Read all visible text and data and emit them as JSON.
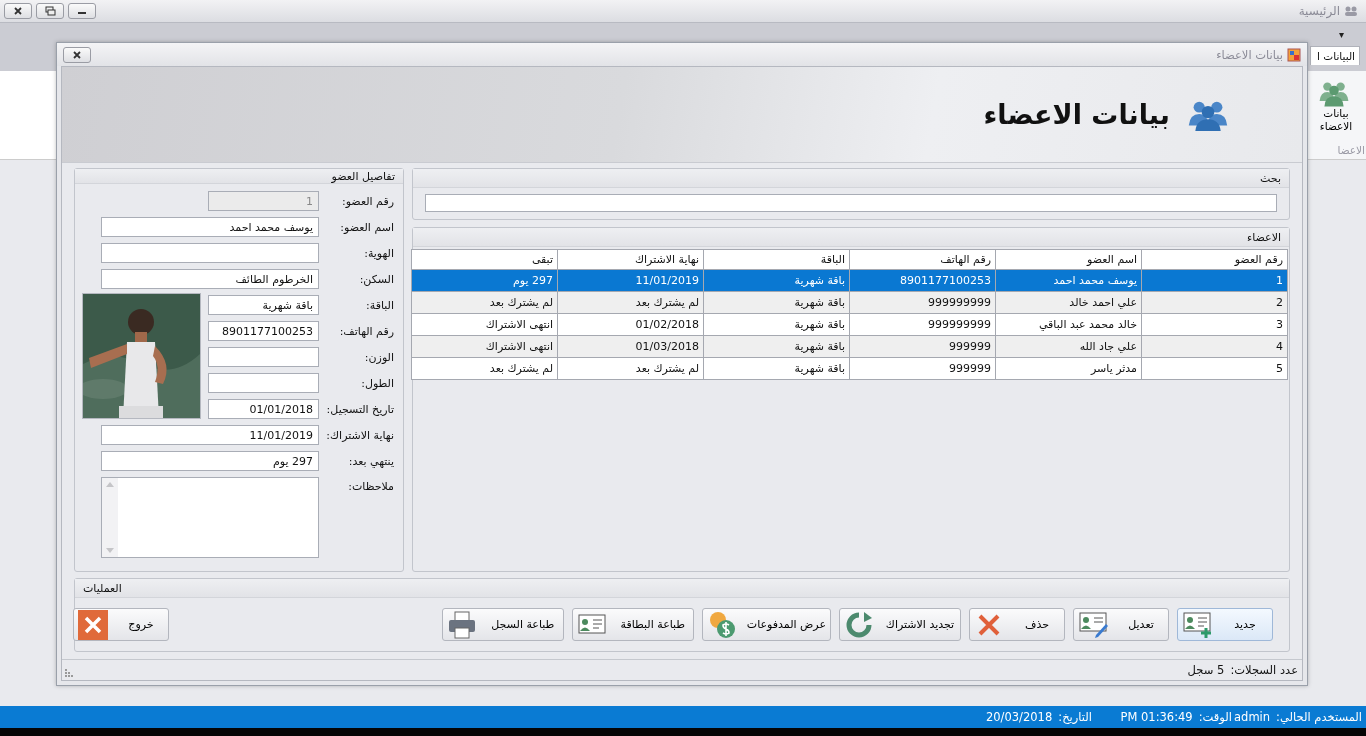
{
  "app": {
    "title": "الرئيسية"
  },
  "ribbon": {
    "menu_caret": "▾",
    "tab": "البيانات ا",
    "button": "بيانات الاعضاء",
    "group": "الاعضا"
  },
  "child_window": {
    "title": "بيانات الاعضاء",
    "heading": "بيانات الاعضاء"
  },
  "details": {
    "title": "تفاصيل العضو",
    "fields": [
      {
        "label": "رقم العضو:",
        "value": "1",
        "kind": "narrow",
        "disabled": true
      },
      {
        "label": "اسم العضو:",
        "value": "يوسف محمد احمد",
        "kind": "wide",
        "disabled": false
      },
      {
        "label": "الهوية:",
        "kind": "wide",
        "disabled": false
      },
      {
        "label": "السكن:",
        "value": "الخرطوم الطائف",
        "kind": "wide",
        "disabled": false
      },
      {
        "label": "الباقة:",
        "value": "باقة شهرية",
        "kind": "narrow",
        "disabled": false
      },
      {
        "label": "رقم الهاتف:",
        "value": "8901177100253",
        "kind": "narrow",
        "disabled": false
      },
      {
        "label": "الوزن:",
        "kind": "narrow",
        "disabled": false
      },
      {
        "label": "الطول:",
        "kind": "narrow",
        "disabled": false
      },
      {
        "label": "تاريخ التسجيل:",
        "value": "01/01/2018",
        "kind": "narrow",
        "disabled": false
      },
      {
        "label": "نهاية الاشتراك:",
        "value": "11/01/2019",
        "kind": "wide",
        "disabled": false
      },
      {
        "label": "ينتهي بعد:",
        "value": "297 يوم",
        "kind": "wide",
        "disabled": false
      },
      {
        "label": "ملاحظات:",
        "kind": "notes",
        "disabled": false
      }
    ]
  },
  "search": {
    "title": "بحث"
  },
  "members": {
    "title": "الاعضاء",
    "columns": [
      "رقم العضو",
      "اسم العضو",
      "رقم الهاتف",
      "الباقة",
      "نهاية الاشتراك",
      "تبقى"
    ],
    "rows": [
      {
        "cells": [
          "1",
          "يوسف محمد احمد",
          "8901177100253",
          "باقة شهرية",
          "11/01/2019",
          "297 يوم"
        ],
        "selected": true
      },
      {
        "cells": [
          "2",
          "علي احمد خالد",
          "999999999",
          "باقة شهرية",
          "لم يشترك بعد",
          "لم يشترك بعد"
        ],
        "selected": false
      },
      {
        "cells": [
          "3",
          "خالد محمد عبد الباقي",
          "999999999",
          "باقة شهرية",
          "01/02/2018",
          "انتهى الاشتراك"
        ],
        "selected": false
      },
      {
        "cells": [
          "4",
          "علي جاد الله",
          "999999",
          "باقة شهرية",
          "01/03/2018",
          "انتهى الاشتراك"
        ],
        "selected": false
      },
      {
        "cells": [
          "5",
          "مدثر ياسر",
          "999999",
          "باقة شهرية",
          "لم يشترك بعد",
          "لم يشترك بعد"
        ],
        "selected": false
      }
    ]
  },
  "operations": {
    "title": "العمليات",
    "buttons": [
      {
        "label": "جديد",
        "kind": "add",
        "highlighted": true
      },
      {
        "label": "تعديل",
        "kind": "edit",
        "highlighted": false
      },
      {
        "label": "حذف",
        "kind": "delete",
        "highlighted": false
      },
      {
        "label": "تجديد الاشتراك",
        "kind": "renew",
        "highlighted": false
      },
      {
        "label": "عرض المدفوعات",
        "kind": "payments",
        "highlighted": false
      },
      {
        "label": "طباعة البطاقة",
        "kind": "card",
        "highlighted": false
      },
      {
        "label": "طباعة السجل",
        "kind": "print",
        "highlighted": false
      },
      {
        "label": "خروج",
        "kind": "exit",
        "highlighted": false
      }
    ]
  },
  "status_bar": {
    "label": "عدد السجلات:",
    "value": "5 سجل"
  },
  "info_bar": [
    {
      "label": "المستخدم الحالي:",
      "value": "admin"
    },
    {
      "label": "الوقت:",
      "value": "PM 01:36:49"
    },
    {
      "label": "التاريخ:",
      "value": "20/03/2018"
    }
  ]
}
